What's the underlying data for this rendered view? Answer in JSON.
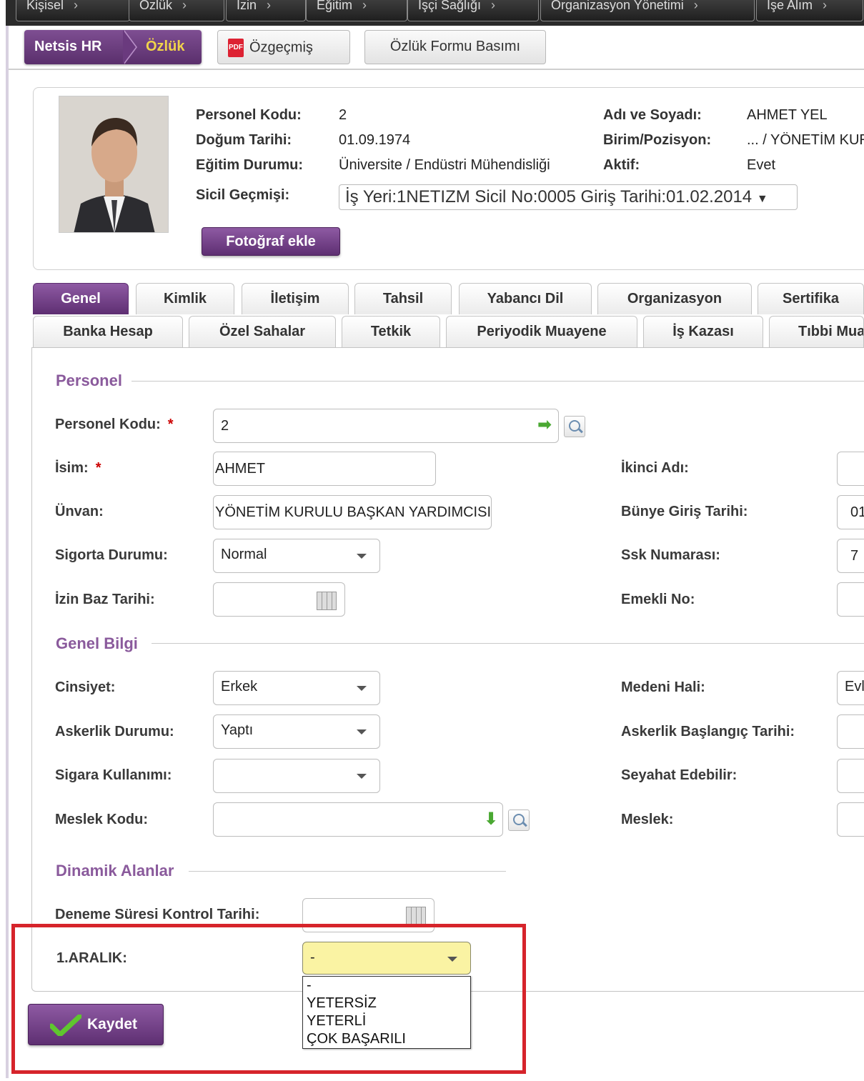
{
  "top_nav": [
    "Kişisel",
    "Özlük",
    "İzin",
    "Eğitim",
    "İşçi Sağlığı",
    "Organizasyon Yönetimi",
    "İşe Alım"
  ],
  "breadcrumb": {
    "root": "Netsis HR",
    "current": "Özlük"
  },
  "toolbar": {
    "cv_label": "Özgeçmiş",
    "form_print_label": "Özlük Formu Basımı"
  },
  "profile": {
    "kod_label": "Personel Kodu:",
    "kod": "2",
    "dogum_label": "Doğum Tarihi:",
    "dogum": "01.09.1974",
    "egitim_label": "Eğitim Durumu:",
    "egitim": "Üniversite / Endüstri Mühendisliği",
    "sicil_label": "Sicil Geçmişi:",
    "sicil": "İş Yeri:1NETIZM Sicil No:0005 Giriş Tarihi:01.02.2014",
    "ad_label": "Adı ve Soyadı:",
    "ad": "AHMET YEL",
    "birim_label": "Birim/Pozisyon:",
    "birim": "... / YÖNETİM KURULU",
    "aktif_label": "Aktif:",
    "aktif": "Evet",
    "photo_button": "Fotoğraf ekle"
  },
  "tabs_row1": [
    "Genel",
    "Kimlik",
    "İletişim",
    "Tahsil",
    "Yabancı Dil",
    "Organizasyon",
    "Sertifika"
  ],
  "tabs_row2": [
    "Banka Hesap",
    "Özel Sahalar",
    "Tetkik",
    "Periyodik Muayene",
    "İş Kazası",
    "Tıbbi Muayene"
  ],
  "sections": {
    "personel": "Personel",
    "genel": "Genel Bilgi",
    "dinamik": "Dinamik Alanlar"
  },
  "fields": {
    "kod_label": "Personel Kodu:",
    "kod_value": "2",
    "isim_label": "İsim:",
    "isim_value": "AHMET",
    "ikinci_label": "İkinci Adı:",
    "unvan_label": "Ünvan:",
    "unvan_value": "YÖNETİM KURULU BAŞKAN YARDIMCISI",
    "bunye_label": "Bünye Giriş Tarihi:",
    "bunye_value": "01",
    "sigorta_label": "Sigorta Durumu:",
    "sigorta_value": "Normal",
    "ssk_label": "Ssk Numarası:",
    "ssk_value": "7",
    "izin_label": "İzin Baz Tarihi:",
    "emekli_label": "Emekli No:",
    "cinsiyet_label": "Cinsiyet:",
    "cinsiyet_value": "Erkek",
    "medeni_label": "Medeni Hali:",
    "medeni_value": "Evli",
    "askerlik_label": "Askerlik Durumu:",
    "askerlik_value": "Yaptı",
    "askerlik_bas_label": "Askerlik Başlangıç Tarihi:",
    "sigara_label": "Sigara Kullanımı:",
    "seyahat_label": "Seyahat Edebilir:",
    "meslek_kodu_label": "Meslek Kodu:",
    "meslek_label": "Meslek:",
    "deneme_label": "Deneme Süresi Kontrol Tarihi:",
    "aralik_label": "1.ARALIK:",
    "aralik_value": "-"
  },
  "aralik_options": [
    "-",
    "YETERSİZ",
    "YETERLİ",
    "ÇOK BAŞARILI"
  ],
  "save_label": "Kaydet",
  "required_mark": "*"
}
